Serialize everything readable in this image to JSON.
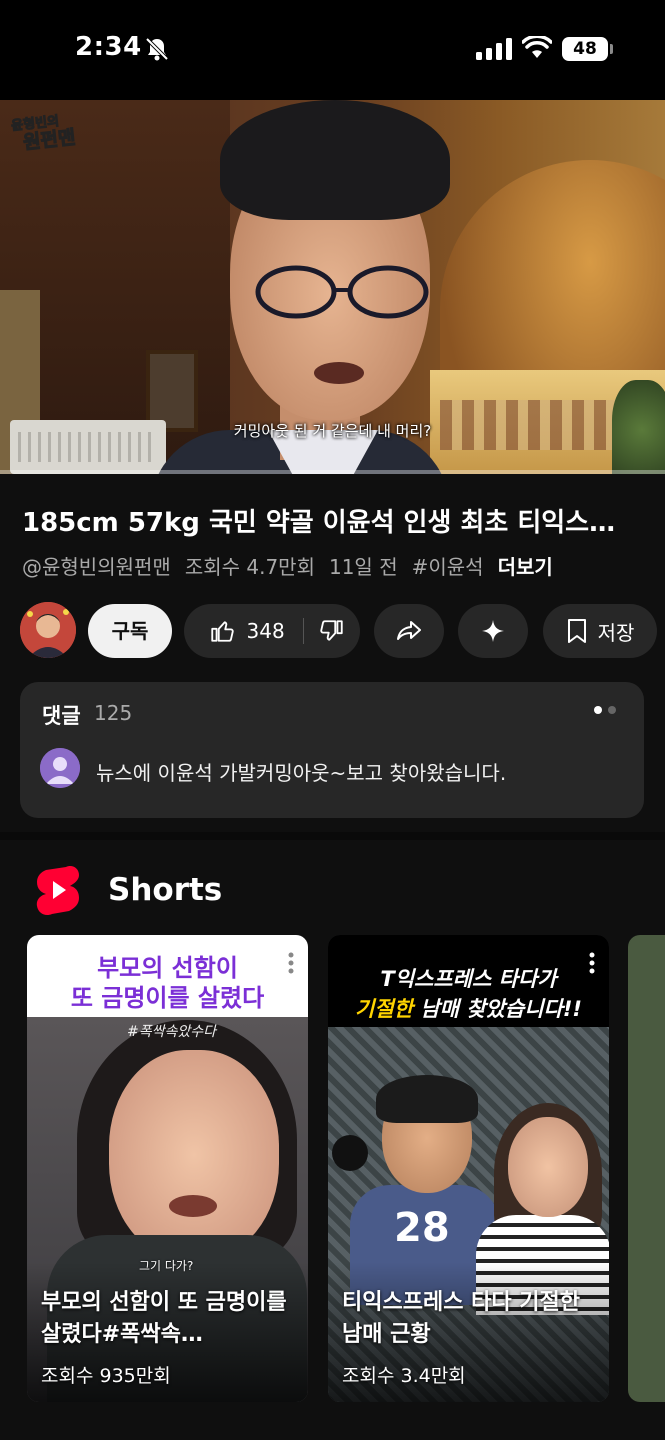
{
  "status_bar": {
    "time": "2:34",
    "battery": "48"
  },
  "video": {
    "channel_logo_text": "윤형빈의 원펀맨",
    "caption": "커밍아웃 된 거 같은데 내 머리?",
    "title": "185cm 57kg 국민 약골 이윤석 인생 최초 티익스…",
    "channel_handle": "@윤형빈의원펀맨",
    "views": "조회수 4.7만회",
    "age": "11일 전",
    "hashtag": "#이윤석",
    "more_label": "더보기"
  },
  "actions": {
    "subscribe_label": "구독",
    "like_count": "348",
    "save_label": "저장"
  },
  "comments": {
    "title": "댓글",
    "count": "125",
    "top_comment": "뉴스에 이윤석 가발커밍아웃~보고 찾아왔습니다."
  },
  "shorts": {
    "section_title": "Shorts",
    "items": [
      {
        "banner_line1": "부모의 선함이",
        "banner_line2": "또 금명이를 살렸다",
        "tag": "#폭싹속았수다",
        "subtitle": "그기 다가?",
        "title": "부모의 선함이 또 금명이를 살렸다#폭싹속…",
        "views": "조회수 935만회"
      },
      {
        "banner_line1": "T익스프레스 타다가",
        "banner_line2_yellow": "기절한",
        "banner_line2_white": " 남매 찾았습니다!!",
        "title": "티익스프레스 타다 기절한 남매 근황",
        "views": "조회수 3.4만회"
      }
    ]
  },
  "colors": {
    "background": "#0f0f0f",
    "surface": "#272727",
    "accent_purple": "#7b2fd6",
    "shorts_red": "#ff0033",
    "highlight_yellow": "#ffd400"
  },
  "icons": [
    "bell-slash-icon",
    "signal-icon",
    "wifi-icon",
    "battery-icon",
    "thumbs-up-icon",
    "thumbs-down-icon",
    "share-icon",
    "sparkle-icon",
    "bookmark-icon",
    "shorts-logo-icon",
    "more-vert-icon"
  ]
}
